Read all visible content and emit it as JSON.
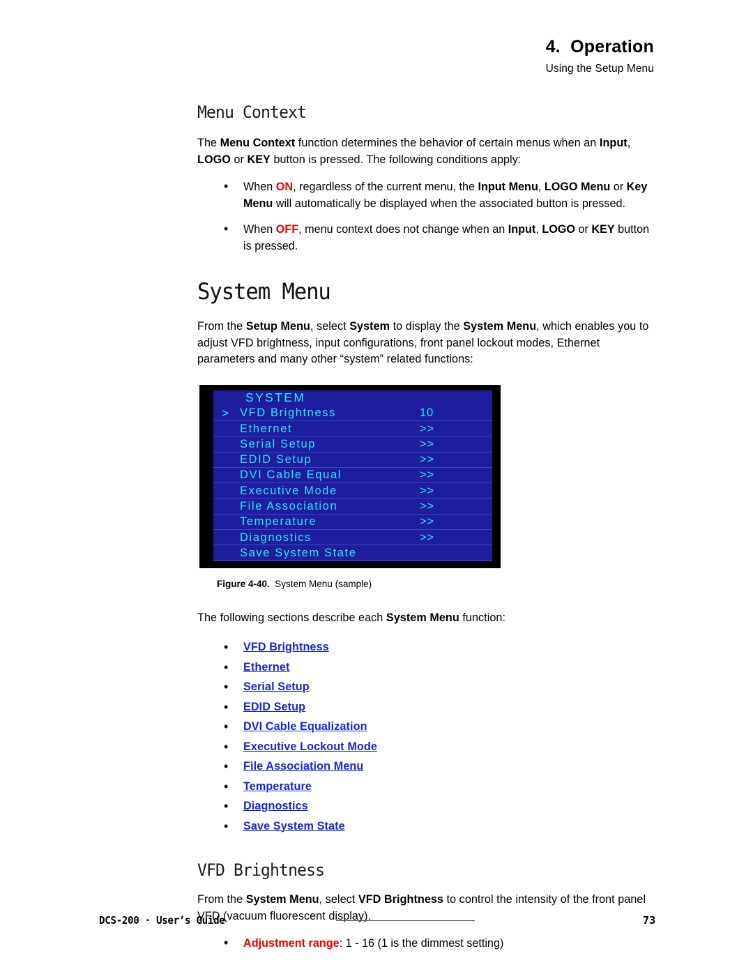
{
  "header": {
    "chapter": "4.  Operation",
    "subtitle": "Using the Setup Menu"
  },
  "menu_context": {
    "heading": "Menu Context",
    "intro_a": "The ",
    "intro_b": "Menu Context",
    "intro_c": " function determines the behavior of certain menus when an ",
    "intro_d": "Input",
    "intro_e": ", ",
    "intro_f": "LOGO",
    "intro_g": " or ",
    "intro_h": "KEY",
    "intro_i": " button is pressed.  The following conditions apply:",
    "bullets": [
      {
        "pre": "When ",
        "state": "ON",
        "post": ", regardless of the current menu, the ",
        "b1": "Input Menu",
        "mid1": ", ",
        "b2": "LOGO Menu",
        "mid2": " or ",
        "b3": "Key Menu",
        "tail": " will automatically be displayed when the associated button is pressed."
      },
      {
        "pre": "When ",
        "state": "OFF",
        "post": ", menu context does not change when an ",
        "b1": "Input",
        "mid1": ", ",
        "b2": "LOGO",
        "mid2": " or ",
        "b3": "KEY",
        "tail": " button is pressed."
      }
    ]
  },
  "system_menu": {
    "heading": "System Menu",
    "intro_a": "From the ",
    "intro_b": "Setup Menu",
    "intro_c": ", select ",
    "intro_d": "System",
    "intro_e": " to display the ",
    "intro_f": "System Menu",
    "intro_g": ", which enables you to adjust VFD brightness, input configurations, front panel lockout modes, Ethernet parameters and many other “system” related functions:",
    "figure": {
      "title": "SYSTEM",
      "selector": ">",
      "rows": [
        {
          "selector": ">",
          "label": "VFD Brightness",
          "value": "10"
        },
        {
          "selector": "",
          "label": "Ethernet",
          "value": ">>"
        },
        {
          "selector": "",
          "label": "Serial Setup",
          "value": ">>"
        },
        {
          "selector": "",
          "label": "EDID Setup",
          "value": ">>"
        },
        {
          "selector": "",
          "label": "DVI Cable Equal",
          "value": ">>"
        },
        {
          "selector": "",
          "label": "Executive Mode",
          "value": ">>"
        },
        {
          "selector": "",
          "label": "File Association",
          "value": ">>"
        },
        {
          "selector": "",
          "label": "Temperature",
          "value": ">>"
        },
        {
          "selector": "",
          "label": "Diagnostics",
          "value": ">>"
        },
        {
          "selector": "",
          "label": "Save System State",
          "value": ""
        }
      ],
      "colors": {
        "screen_bg": "#1d1d9e",
        "bezel": "#000000",
        "text": "#2ae9f3"
      }
    },
    "caption_label": "Figure 4-40.",
    "caption_text": "System Menu (sample)",
    "list_intro_a": "The following sections describe each ",
    "list_intro_b": "System Menu",
    "list_intro_c": " function:",
    "links": [
      "VFD Brightness",
      "Ethernet",
      "Serial Setup",
      "EDID Setup",
      "DVI Cable Equalization",
      "Executive Lockout Mode",
      "File Association Menu",
      "Temperature",
      "Diagnostics",
      "Save System State"
    ],
    "link_color": "#1923d8"
  },
  "vfd_brightness": {
    "heading": "VFD Brightness",
    "intro_a": "From the ",
    "intro_b": "System Menu",
    "intro_c": ", select ",
    "intro_d": "VFD Brightness",
    "intro_e": " to control the intensity of the front panel VFD (vacuum fluorescent display).",
    "bullet_label": "Adjustment range",
    "bullet_text": ":  1 - 16 (1 is the dimmest setting)"
  },
  "footer": {
    "left": "DCS-200  ·  User’s Guide",
    "page": "73"
  }
}
